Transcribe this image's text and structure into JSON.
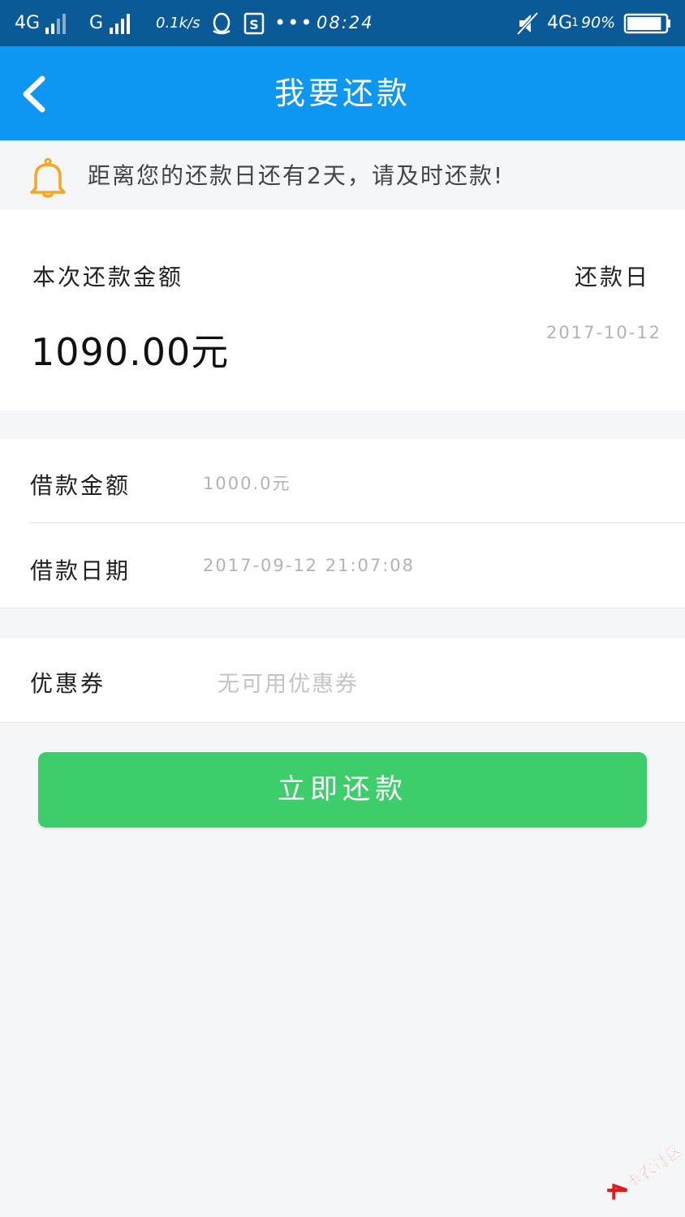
{
  "status_bar": {
    "network1": "4G",
    "network2": "G",
    "speed": "0.1k/s",
    "time": "08:24",
    "network3": "4G",
    "sim_indicator": "1",
    "battery_pct": "90%",
    "battery_level": 0.9
  },
  "header": {
    "title": "我要还款"
  },
  "notice": {
    "text": "距离您的还款日还有2天，请及时还款!"
  },
  "summary": {
    "amount_label": "本次还款金额",
    "amount_value": "1090.00元",
    "due_label": "还款日",
    "due_date": "2017-10-12"
  },
  "loan": {
    "amount_label": "借款金额",
    "amount_value": "1000.0元",
    "date_label": "借款日期",
    "date_value": "2017-09-12  21:07:08"
  },
  "coupon": {
    "label": "优惠券",
    "value": "无可用优惠券"
  },
  "action": {
    "repay_label": "立即还款"
  },
  "watermark": {
    "text": "卡农社区"
  },
  "colors": {
    "status_bar": "#0a5a98",
    "header": "#0d96f2",
    "button": "#3ecd6b",
    "bell": "#f5a623"
  }
}
